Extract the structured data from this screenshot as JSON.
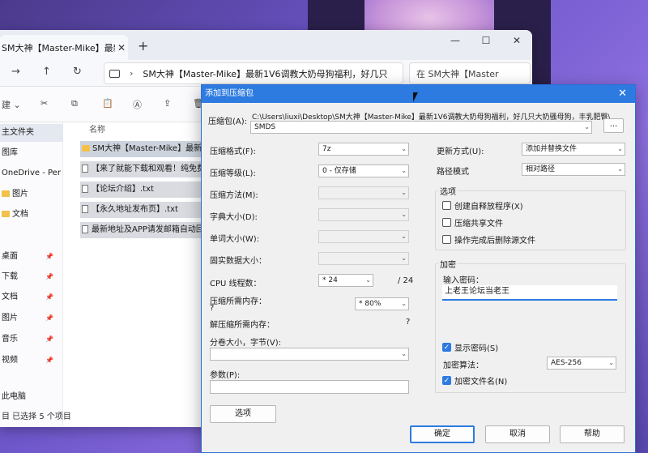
{
  "explorer": {
    "tab_title": "SM大神【Master-Mike】最新1",
    "address": "SM大神【Master-Mike】最新1V6调教大奶母狗福利，好几只",
    "search_placeholder": "在 SM大神【Master",
    "new_label": "建",
    "column_name": "名称",
    "sidebar": [
      {
        "label": "主文件夹",
        "active": true
      },
      {
        "label": "图库"
      },
      {
        "label": "OneDrive - Per"
      },
      {
        "label": "图片",
        "folder": true
      },
      {
        "label": "文档",
        "folder": true
      },
      {
        "label": "桌面",
        "pinned": true
      },
      {
        "label": "下载",
        "pinned": true
      },
      {
        "label": "文档",
        "pinned": true
      },
      {
        "label": "图片",
        "pinned": true
      },
      {
        "label": "音乐",
        "pinned": true
      },
      {
        "label": "视频",
        "pinned": true
      },
      {
        "label": "此电脑"
      }
    ],
    "files": [
      "SM大神【Master-Mike】最新",
      "【来了就能下载和观看！纯免费",
      "【论坛介绍】.txt",
      "【永久地址发布页】.txt",
      "最新地址及APP请发邮箱自动回"
    ],
    "status": "目 已选择 5 个项目"
  },
  "dialog": {
    "title": "添加到压缩包",
    "archive_label": "压缩包(A):",
    "archive_path": "C:\\Users\\liuxi\\Desktop\\SM大神【Master-Mike】最新1V6调教大奶母狗福利，好几只大奶骚母狗，丰乳肥臀\\",
    "archive_name": "SMDS",
    "browse_label": "...",
    "format_label": "压缩格式(F):",
    "format_value": "7z",
    "level_label": "压缩等级(L):",
    "level_value": "0 - 仅存储",
    "method_label": "压缩方法(M):",
    "dict_label": "字典大小(D):",
    "word_label": "单词大小(W):",
    "solid_label": "固实数据大小：",
    "cpu_label": "CPU 线程数：",
    "cpu_value": "* 24",
    "cpu_total": "/ 24",
    "mem_label": "压缩所需内存：",
    "mem_q": "?",
    "mem_value": "* 80%",
    "decomp_label": "解压缩所需内存：",
    "decomp_q": "?",
    "split_label": "分卷大小，字节(V):",
    "params_label": "参数(P):",
    "options_button": "选项",
    "update_label": "更新方式(U):",
    "update_value": "添加并替换文件",
    "pathmode_label": "路径模式",
    "pathmode_value": "相对路径",
    "options_group": "选项",
    "opt_sfx": "创建自释放程序(X)",
    "opt_shared": "压缩共享文件",
    "opt_delete": "操作完成后删除源文件",
    "encrypt_group": "加密",
    "password_label": "输入密码：",
    "password_value": "上老王论坛当老王",
    "show_password": "显示密码(S)",
    "enc_method_label": "加密算法：",
    "enc_method_value": "AES-256",
    "enc_names": "加密文件名(N)",
    "ok": "确定",
    "cancel": "取消",
    "help": "帮助"
  },
  "colors": {
    "accent": "#2d7be0",
    "title_bar": "#2d7be0"
  }
}
